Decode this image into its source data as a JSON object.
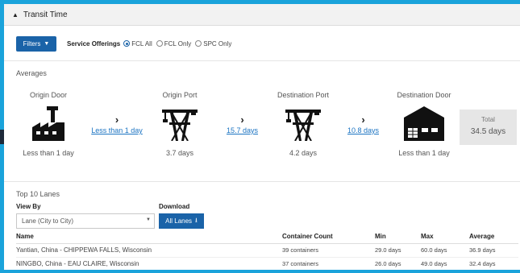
{
  "header": {
    "title": "Transit Time",
    "collapse_icon": "caret-up-icon"
  },
  "filters": {
    "button_label": "Filters",
    "service_offerings_label": "Service Offerings",
    "options": [
      {
        "label": "FCL All",
        "selected": true
      },
      {
        "label": "FCL Only",
        "selected": false
      },
      {
        "label": "SPC Only",
        "selected": false
      }
    ]
  },
  "averages": {
    "label": "Averages",
    "stages": [
      {
        "title": "Origin Door",
        "value": "Less than 1 day",
        "icon": "factory-icon"
      },
      {
        "title": "Origin Port",
        "value": "3.7 days",
        "icon": "port-crane-icon"
      },
      {
        "title": "Destination Port",
        "value": "4.2 days",
        "icon": "port-crane-icon"
      },
      {
        "title": "Destination Door",
        "value": "Less than 1 day",
        "icon": "warehouse-icon"
      }
    ],
    "transitions": [
      {
        "label": "Less than 1 day"
      },
      {
        "label": "15.7 days"
      },
      {
        "label": "10.8 days"
      }
    ],
    "total": {
      "label": "Total",
      "value": "34.5 days"
    }
  },
  "lanes": {
    "title": "Top 10 Lanes",
    "view_by_label": "View By",
    "view_by_value": "Lane (City to City)",
    "download_label": "Download",
    "download_button": "All Lanes",
    "columns": [
      "Name",
      "Container Count",
      "Min",
      "Max",
      "Average"
    ],
    "rows": [
      [
        "Yantian, China - CHIPPEWA FALLS, Wisconsin",
        "39 containers",
        "29.0 days",
        "60.0 days",
        "36.9 days"
      ],
      [
        "NINGBO, China - EAU CLAIRE, Wisconsin",
        "37 containers",
        "26.0 days",
        "49.0 days",
        "32.4 days"
      ]
    ]
  },
  "colors": {
    "accent": "#1a63a8",
    "frame": "#1aa3db",
    "link": "#1a73c2"
  }
}
